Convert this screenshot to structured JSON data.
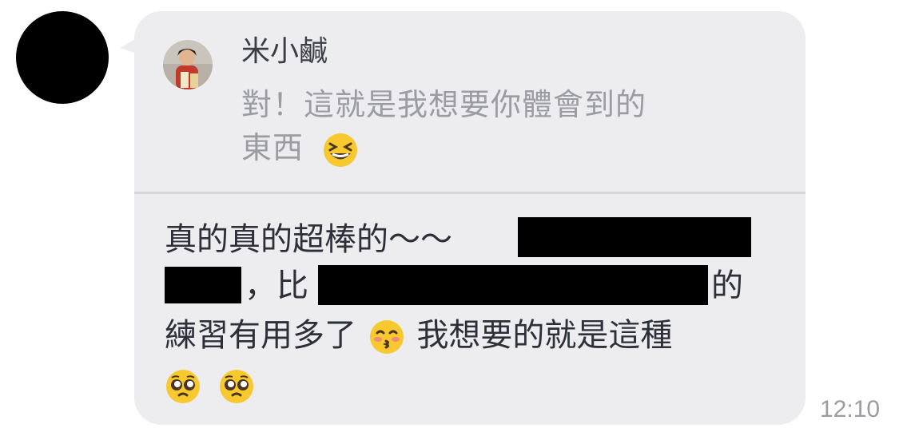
{
  "sender": {
    "avatar_icon": "avatar-blacked-out"
  },
  "quoted_message": {
    "author": "米小鹹",
    "text": "對！這就是我想要你體會到的東西",
    "text_line1": "對！這就是我想要你體會到的",
    "text_line2": "東西",
    "emoji": "grinning-squinting-face-icon"
  },
  "reply": {
    "line1": "真的真的超棒的～～",
    "line2_a": "，比",
    "line2_b": "的",
    "line3_a": "練習有用多了",
    "line3_b": "我想要的就是這種",
    "emojis": [
      "kissing-face-icon",
      "pleading-face-icon",
      "pleading-face-icon"
    ]
  },
  "timestamp": "12:10",
  "colors": {
    "bubble": "#ededf0",
    "quote_text": "#9a9ca2",
    "reply_text": "#2d3038",
    "redaction": "#000000"
  }
}
